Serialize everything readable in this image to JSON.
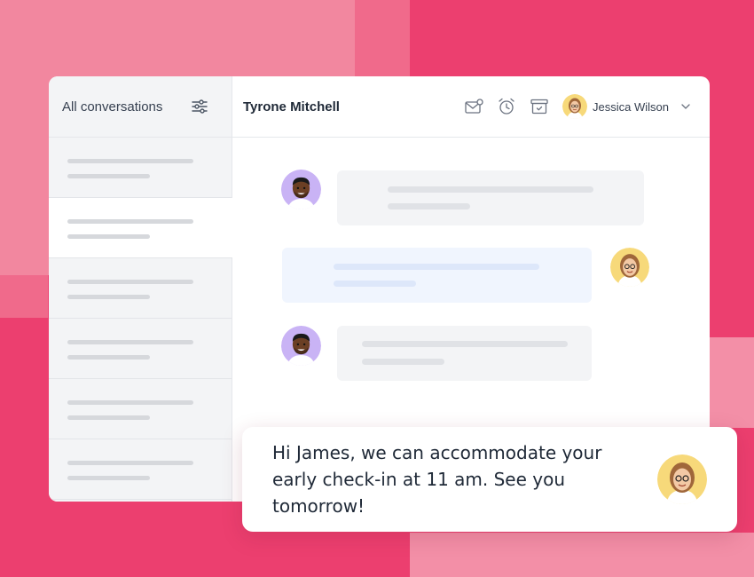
{
  "sidebar": {
    "title": "All conversations",
    "filter_icon": "sliders-icon",
    "items": [
      {
        "selected": false
      },
      {
        "selected": true
      },
      {
        "selected": false
      },
      {
        "selected": false
      },
      {
        "selected": false
      },
      {
        "selected": false
      }
    ]
  },
  "header": {
    "contact_name": "Tyrone Mitchell",
    "icons": [
      "mail-notification-icon",
      "alarm-clock-icon",
      "archive-icon"
    ],
    "agent_name": "Jessica Wilson"
  },
  "reply": {
    "text": "Hi James, we can accommodate your early check-in at 11 am. See you tomorrow!"
  },
  "colors": {
    "background": "#ec3f6f",
    "accent_pink": "#f2879f",
    "customer_avatar_bg": "#c9b3f5",
    "agent_avatar_bg": "#f7d97a"
  }
}
